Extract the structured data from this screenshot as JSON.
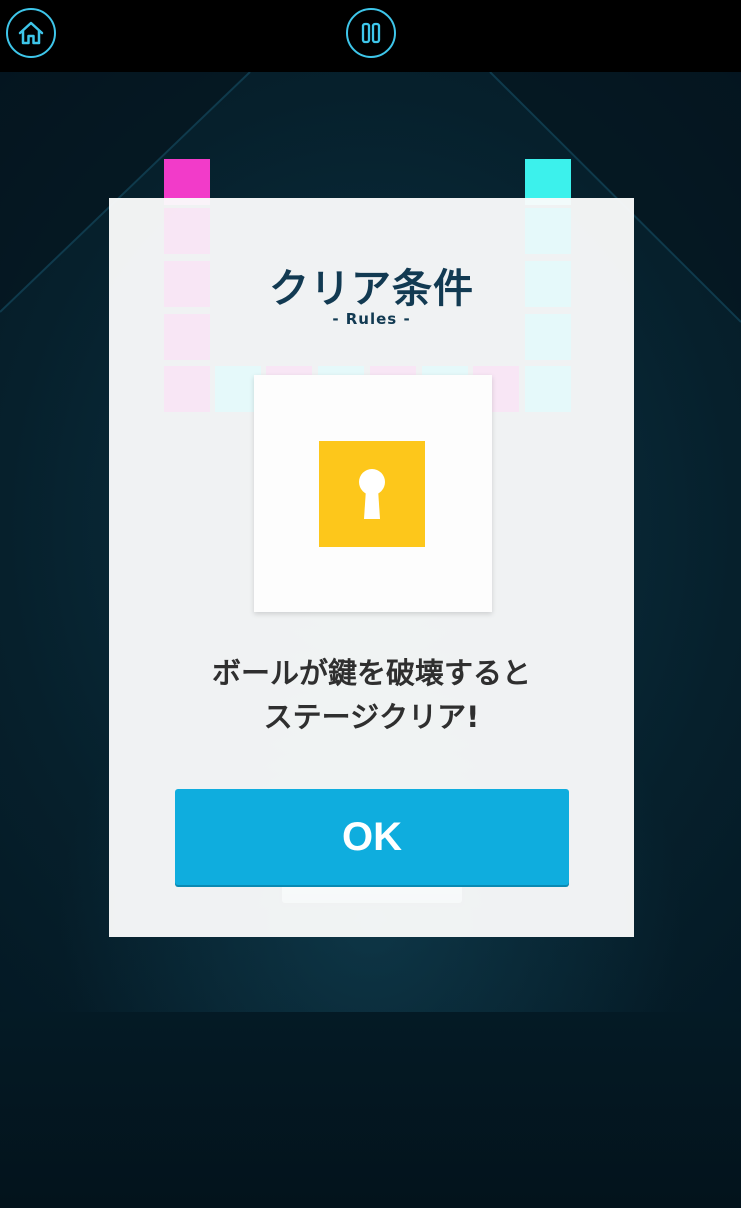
{
  "hud": {
    "home_icon": "home-icon",
    "pause_icon": "pause-icon",
    "accent_color": "#3ec6ea"
  },
  "dialog": {
    "title": "クリア条件",
    "subtitle": "- Rules -",
    "key_icon": "keyhole-icon",
    "message_line1": "ボールが鍵を破壊すると",
    "message_line2": "ステージクリア!",
    "ok_label": "OK"
  },
  "colors": {
    "block_pink": "#f23bc9",
    "block_cyan": "#3cf1ec",
    "key_yellow": "#fdc71b",
    "button_blue": "#0fadde"
  }
}
